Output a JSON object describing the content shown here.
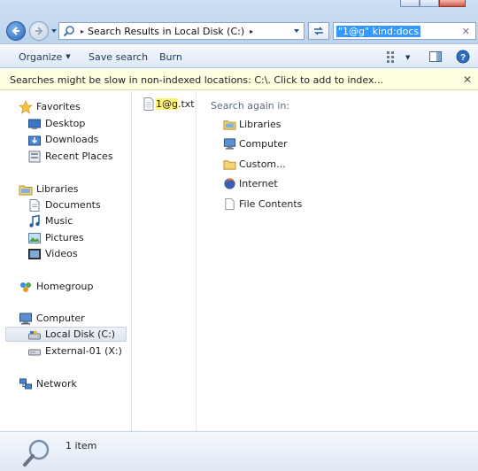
{
  "address": {
    "separator": "▸",
    "path_label": "Search Results in Local Disk (C:)",
    "trail_separator": "▸"
  },
  "search": {
    "query": "\"1@g\"  kind:docs",
    "clear_glyph": "✕"
  },
  "toolbar": {
    "organize_label": "Organize",
    "organize_caret": "▼",
    "save_search_label": "Save search",
    "burn_label": "Burn",
    "views_caret": "▼"
  },
  "infobar": {
    "message": "Searches might be slow in non-indexed locations: C:\\. Click to add to index...",
    "close_glyph": "✕"
  },
  "navigation": {
    "favorites": {
      "label": "Favorites",
      "icon": "star-icon"
    },
    "desktop": {
      "label": "Desktop",
      "icon": "desktop-icon"
    },
    "downloads": {
      "label": "Downloads",
      "icon": "downloads-icon"
    },
    "recent_places": {
      "label": "Recent Places",
      "icon": "recent-places-icon"
    },
    "libraries": {
      "label": "Libraries",
      "icon": "libraries-icon"
    },
    "documents": {
      "label": "Documents",
      "icon": "documents-icon"
    },
    "music": {
      "label": "Music",
      "icon": "music-icon"
    },
    "pictures": {
      "label": "Pictures",
      "icon": "pictures-icon"
    },
    "videos": {
      "label": "Videos",
      "icon": "videos-icon"
    },
    "homegroup": {
      "label": "Homegroup",
      "icon": "homegroup-icon"
    },
    "computer": {
      "label": "Computer",
      "icon": "computer-icon"
    },
    "local_disk": {
      "label": "Local Disk (C:)",
      "icon": "local-disk-icon",
      "selected": true
    },
    "external": {
      "label": "External-01 (X:)",
      "icon": "external-drive-icon"
    },
    "network": {
      "label": "Network",
      "icon": "network-icon"
    }
  },
  "results": {
    "file": {
      "name_highlight": "1@g",
      "name_rest": ".txt",
      "icon": "text-file-icon"
    }
  },
  "search_again": {
    "heading": "Search again in:",
    "items": [
      {
        "label": "Libraries",
        "icon": "libraries-icon"
      },
      {
        "label": "Computer",
        "icon": "computer-icon"
      },
      {
        "label": "Custom...",
        "icon": "folder-icon"
      },
      {
        "label": "Internet",
        "icon": "internet-icon"
      },
      {
        "label": "File Contents",
        "icon": "file-icon"
      }
    ]
  },
  "details": {
    "item_count": "1 item",
    "icon": "search-magnifier-icon"
  },
  "colors": {
    "selection": "#3399ff",
    "infobar": "#ffffe1",
    "highlight": "#fff37a",
    "toolbar_text": "#1e395b"
  }
}
